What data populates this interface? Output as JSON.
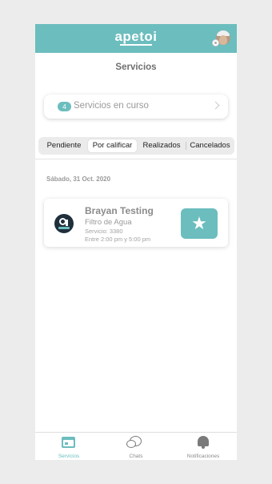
{
  "header": {
    "logo_text": "apetoi",
    "brand_color": "#6cbdbe"
  },
  "page": {
    "title": "Servicios"
  },
  "in_progress": {
    "count": "4",
    "label": "Servicios en curso"
  },
  "tabs": [
    {
      "label": "Pendiente",
      "selected": false
    },
    {
      "label": "Por calificar",
      "selected": true
    },
    {
      "label": "Realizados",
      "selected": false
    },
    {
      "label": "Cancelados",
      "selected": false
    }
  ],
  "groups": [
    {
      "date": "Sábado, 31 Oct. 2020",
      "items": [
        {
          "name": "Brayan Testing",
          "product": "Filtro de Agua",
          "service": "Servicio: 3380",
          "time": "Entre 2:00 pm y 5:00 pm",
          "action_icon": "star-icon",
          "action_glyph": "★"
        }
      ]
    }
  ],
  "bottom_nav": [
    {
      "label": "Servicios",
      "icon": "calendar-icon",
      "active": true
    },
    {
      "label": "Chats",
      "icon": "chat-bubbles-icon",
      "active": false
    },
    {
      "label": "Notificaciones",
      "icon": "bell-icon",
      "active": false
    }
  ]
}
